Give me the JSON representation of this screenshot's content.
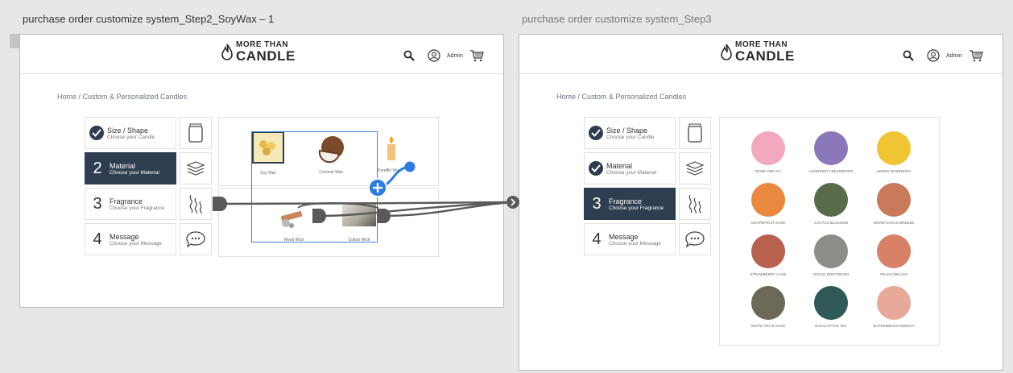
{
  "frames": [
    {
      "title": "purchase order customize system_Step2_SoyWax – 1"
    },
    {
      "title": "purchase order customize system_Step3"
    }
  ],
  "logo": {
    "line1": "MORE THAN",
    "line2": "CANDLE"
  },
  "header": {
    "admin_label": "Admin"
  },
  "breadcrumb": "Home / Custom & Personalized Candles",
  "steps_left": [
    {
      "num": "",
      "title": "Size / Shape",
      "sub": "Choose your Candle"
    },
    {
      "num": "2",
      "title": "Material",
      "sub": "Choose your Material"
    },
    {
      "num": "3",
      "title": "Fragrance",
      "sub": "Choose your Fragrance"
    },
    {
      "num": "4",
      "title": "Message",
      "sub": "Choose your Message"
    }
  ],
  "steps_right": [
    {
      "num": "",
      "title": "Size / Shape",
      "sub": "Choose your Candle"
    },
    {
      "num": "",
      "title": "Material",
      "sub": "Choose your Material"
    },
    {
      "num": "3",
      "title": "Fragrance",
      "sub": "Choose your Fragrance"
    },
    {
      "num": "4",
      "title": "Message",
      "sub": "Choose your Message"
    }
  ],
  "materials": [
    {
      "label": "Soy Wax"
    },
    {
      "label": "Coconut Wax"
    },
    {
      "label": "Paraffin Wax"
    },
    {
      "label": "Wood Wick"
    },
    {
      "label": "Cotton Wick"
    }
  ],
  "fragrances": [
    {
      "label": "ROSE AND IVY",
      "color": "#f2a9bd"
    },
    {
      "label": "LAVENDER CEDARWOOD",
      "color": "#8a78b8"
    },
    {
      "label": "LEMON ROSEMARY",
      "color": "#f0c534"
    },
    {
      "label": "GRAPEFRUIT SAGE",
      "color": "#e9893f"
    },
    {
      "label": "CACTUS BLOSSOM",
      "color": "#5a6b4a"
    },
    {
      "label": "WARM OCEAN BREEZE",
      "color": "#c87a5a"
    },
    {
      "label": "STRAWBERRY CAKE",
      "color": "#b8614e"
    },
    {
      "label": "OCEAN DRIFTWOOD",
      "color": "#8c8c88"
    },
    {
      "label": "PEACH BELLINI",
      "color": "#d98068"
    },
    {
      "label": "WHITE TEA & SAGE",
      "color": "#6c6a56"
    },
    {
      "label": "EUCALYPTUS TEA",
      "color": "#2f5a58"
    },
    {
      "label": "WATERMELON ENERGY",
      "color": "#e8a89a"
    }
  ],
  "colors": {
    "navy": "#2f3d51",
    "link_blue": "#2d7be0",
    "connector": "#5a5a5a"
  }
}
